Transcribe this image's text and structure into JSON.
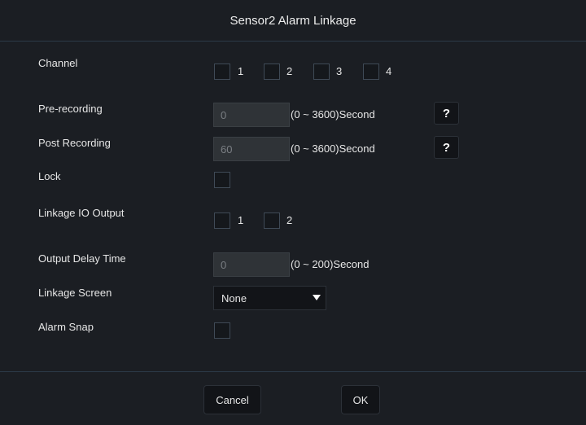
{
  "dialog": {
    "title": "Sensor2 Alarm Linkage"
  },
  "channel": {
    "label": "Channel",
    "options": [
      "1",
      "2",
      "3",
      "4"
    ]
  },
  "pre_recording": {
    "label": "Pre-recording",
    "value": "0",
    "range": "(0 ~ 3600)Second",
    "help": "?"
  },
  "post_recording": {
    "label": "Post Recording",
    "value": "60",
    "range": "(0 ~ 3600)Second",
    "help": "?"
  },
  "lock": {
    "label": "Lock"
  },
  "linkage_io_output": {
    "label": "Linkage IO Output",
    "options": [
      "1",
      "2"
    ]
  },
  "output_delay_time": {
    "label": "Output Delay Time",
    "value": "0",
    "range": "(0 ~ 200)Second"
  },
  "linkage_screen": {
    "label": "Linkage Screen",
    "selected": "None"
  },
  "alarm_snap": {
    "label": "Alarm Snap"
  },
  "footer": {
    "cancel_label": "Cancel",
    "ok_label": "OK"
  }
}
